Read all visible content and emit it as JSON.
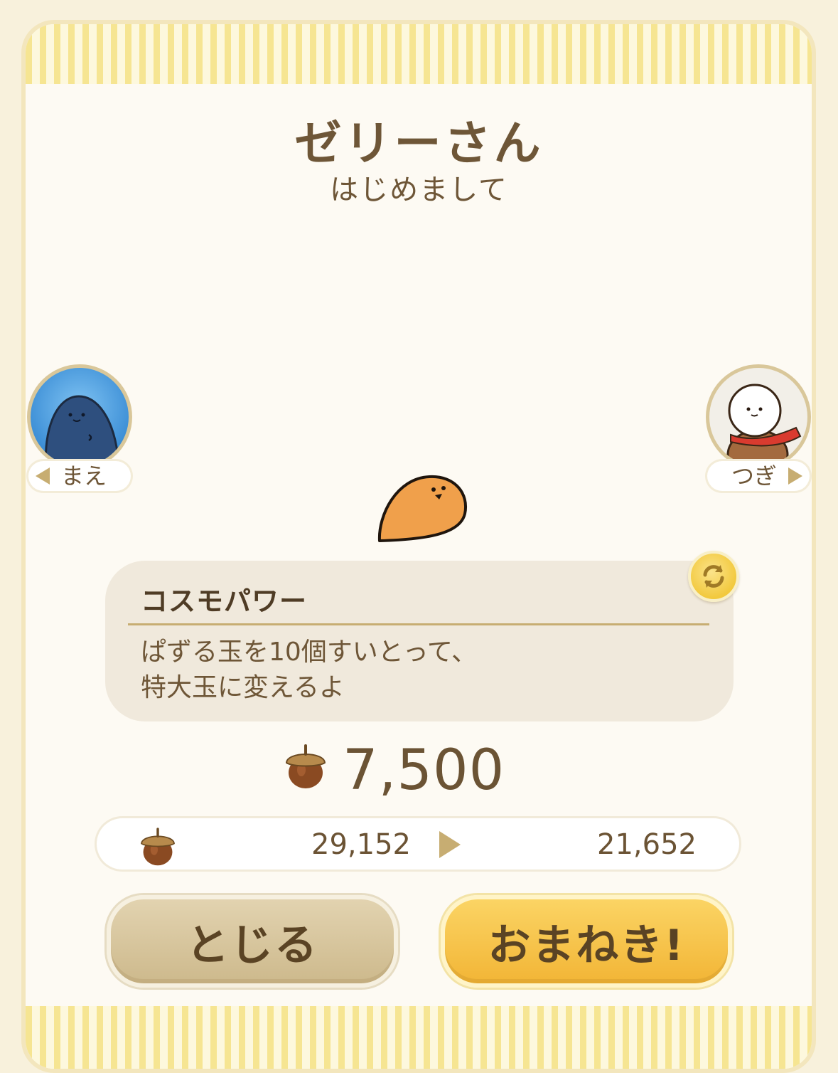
{
  "header": {
    "title": "ゼリーさん",
    "subtitle": "はじめまして"
  },
  "nav": {
    "prev_label": "まえ",
    "next_label": "つぎ"
  },
  "skill": {
    "name": "コスモパワー",
    "description_line1": "ぱずる玉を10個すいとって、",
    "description_line2": "特大玉に変えるよ",
    "refresh_icon": "refresh-icon"
  },
  "price": {
    "icon": "acorn-icon",
    "value": "7,500"
  },
  "balance": {
    "icon": "acorn-icon",
    "current": "29,152",
    "after": "21,652"
  },
  "buttons": {
    "close_label": "とじる",
    "invite_label": "おまねき!"
  },
  "colors": {
    "text_brown": "#6e5637",
    "accent_gold": "#c7ad72",
    "invite_yellow": "#f2b536",
    "stripe_yellow": "#f6e592"
  }
}
